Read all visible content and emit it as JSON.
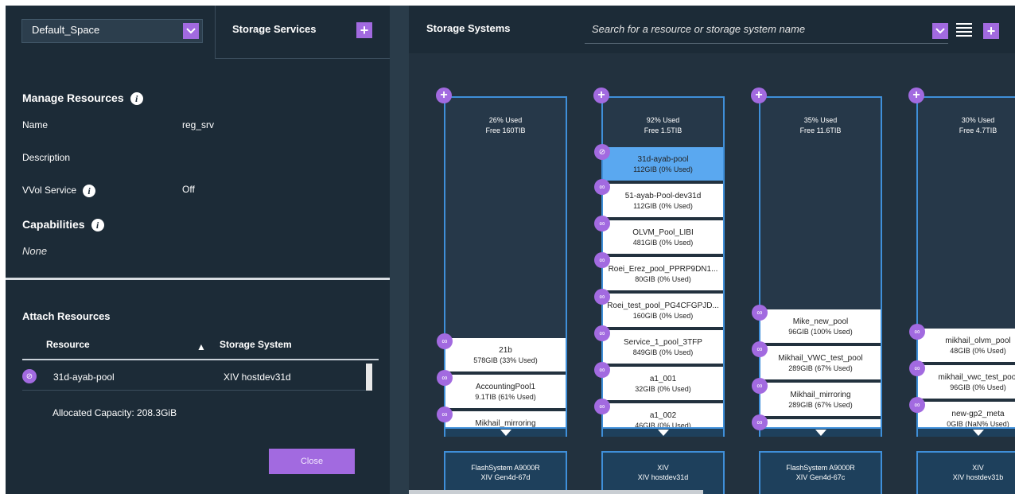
{
  "left": {
    "space_select": "Default_Space",
    "tab_label": "Storage Services",
    "manage_title": "Manage Resources",
    "name_label": "Name",
    "name_value": "reg_srv",
    "description_label": "Description",
    "vvol_label": "VVol Service",
    "vvol_value": "Off",
    "capabilities_title": "Capabilities",
    "capabilities_value": "None",
    "attach_title": "Attach Resources",
    "col_resource": "Resource",
    "col_system": "Storage System",
    "row_resource": "31d-ayab-pool",
    "row_system": "XIV hostdev31d",
    "allocated": "Allocated Capacity: 208.3GiB",
    "close_label": "Close"
  },
  "right": {
    "title": "Storage Systems",
    "search_placeholder": "Search for a resource or storage system name",
    "columns": [
      {
        "used": "26% Used",
        "free": "Free 160TIB",
        "pools": [
          {
            "name": "21b",
            "cap": "578GIB (33% Used)"
          },
          {
            "name": "AccountingPool1",
            "cap": "9.1TIB (61% Used)"
          },
          {
            "name": "Mikhail_mirroring",
            "cap": ""
          }
        ],
        "system_type": "FlashSystem A9000R",
        "system_name": "XIV Gen4d-67d"
      },
      {
        "used": "92% Used",
        "free": "Free 1.5TIB",
        "pools": [
          {
            "name": "31d-ayab-pool",
            "cap": "112GIB (0% Used)"
          },
          {
            "name": "51-ayab-Pool-dev31d",
            "cap": "112GIB (0% Used)"
          },
          {
            "name": "OLVM_Pool_LIBI",
            "cap": "481GIB (0% Used)"
          },
          {
            "name": "Roei_Erez_pool_PPRP9DN1...",
            "cap": "80GIB (0% Used)"
          },
          {
            "name": "Roei_test_pool_PG4CFGPJD...",
            "cap": "160GIB (0% Used)"
          },
          {
            "name": "Service_1_pool_3TFP",
            "cap": "849GIB (0% Used)"
          },
          {
            "name": "a1_001",
            "cap": "32GIB (0% Used)"
          },
          {
            "name": "a1_002",
            "cap": "46GIB (0% Used)"
          }
        ],
        "system_type": "XIV",
        "system_name": "XIV hostdev31d"
      },
      {
        "used": "35% Used",
        "free": "Free 11.6TIB",
        "pools": [
          {
            "name": "Mike_new_pool",
            "cap": "96GIB (100% Used)"
          },
          {
            "name": "Mikhail_VWC_test_pool",
            "cap": "289GIB (67% Used)"
          },
          {
            "name": "Mikhail_mirroring",
            "cap": "289GIB (67% Used)"
          },
          {
            "name": "",
            "cap": ""
          }
        ],
        "system_type": "FlashSystem A9000R",
        "system_name": "XIV Gen4d-67c"
      },
      {
        "used": "30% Used",
        "free": "Free 4.7TIB",
        "pools": [
          {
            "name": "mikhail_olvm_pool",
            "cap": "48GIB (0% Used)"
          },
          {
            "name": "mikhail_vwc_test_pool",
            "cap": "96GIB (0% Used)"
          },
          {
            "name": "new-gp2_meta",
            "cap": "0GIB (NaN% Used)"
          }
        ],
        "system_type": "XIV",
        "system_name": "XIV hostdev31b"
      }
    ]
  },
  "colors": {
    "accent": "#a26ae0",
    "selected": "#5aa8f0",
    "border": "#3f8fd9",
    "panel": "#1c2b37"
  }
}
